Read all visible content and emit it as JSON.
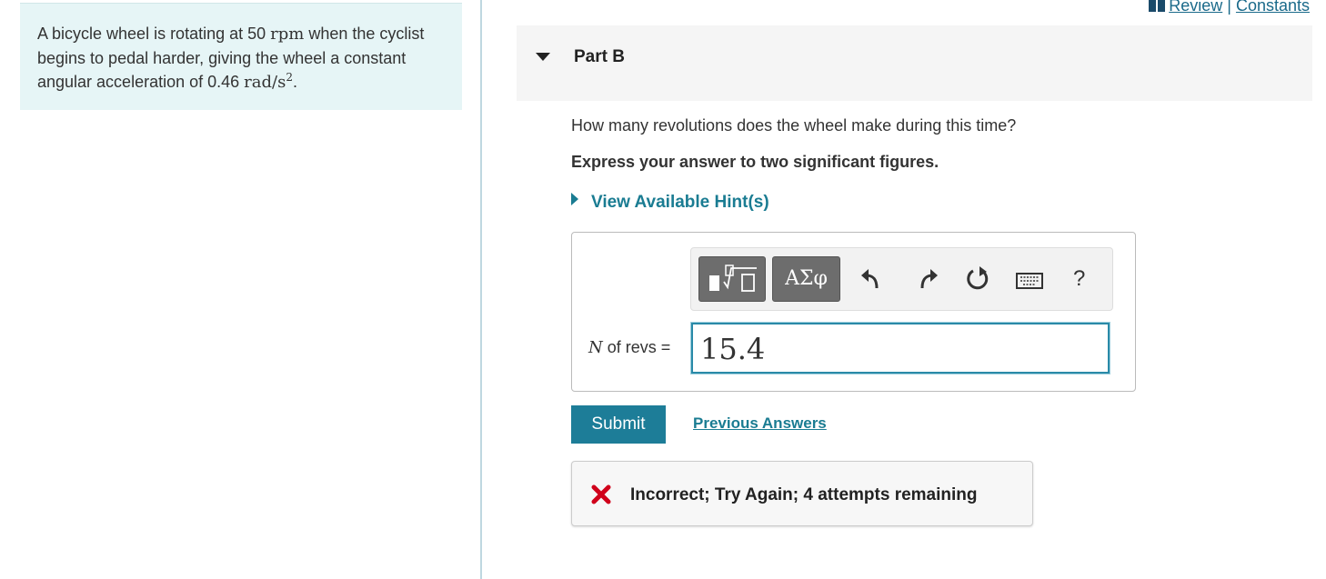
{
  "problem": {
    "text_before_rpm": "A bicycle wheel is rotating at 50 ",
    "rpm_unit": "rpm",
    "text_after_rpm": " when the cyclist begins to pedal harder, giving the wheel a constant angular acceleration of 0.46 ",
    "accel_unit": "rad/s",
    "accel_exp": "2",
    "end": "."
  },
  "top_links": {
    "review": "Review",
    "separator": "|",
    "constants": "Constants"
  },
  "part": {
    "title": "Part B"
  },
  "question": {
    "text": "How many revolutions does the wheel make during this time?",
    "instruction": "Express your answer to two significant figures.",
    "hint_link": "View Available Hint(s)"
  },
  "toolbar": {
    "greek_label": "ΑΣφ",
    "help_label": "?",
    "icons": [
      "templates-icon",
      "undo-icon",
      "redo-icon",
      "reset-icon",
      "keyboard-icon",
      "help-icon"
    ]
  },
  "answer": {
    "variable": "N",
    "label_suffix": " of revs =",
    "value": "15.4"
  },
  "actions": {
    "submit": "Submit",
    "previous": "Previous Answers"
  },
  "feedback": {
    "message": "Incorrect; Try Again; 4 attempts remaining",
    "icon": "x-mark-icon",
    "color": "#d0021b"
  },
  "colors": {
    "accent": "#1d7d98",
    "problem_bg": "#e6f5f6"
  }
}
